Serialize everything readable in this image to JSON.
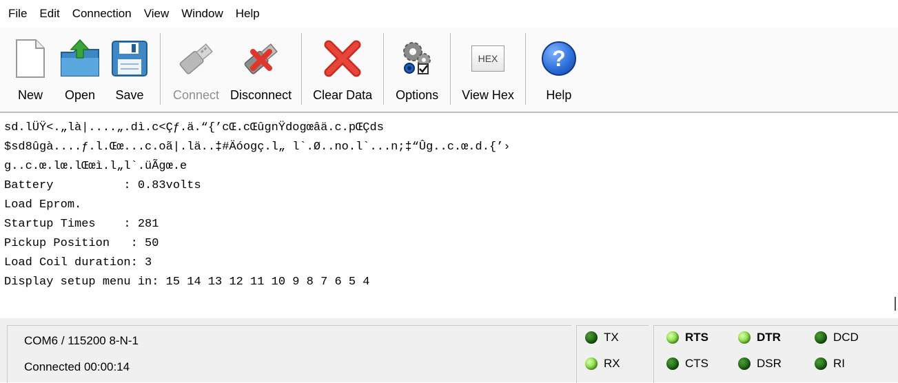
{
  "menu": [
    "File",
    "Edit",
    "Connection",
    "View",
    "Window",
    "Help"
  ],
  "toolbar": {
    "new": {
      "label": "New",
      "icon": "new-document-icon"
    },
    "open": {
      "label": "Open",
      "icon": "open-folder-icon"
    },
    "save": {
      "label": "Save",
      "icon": "floppy-disk-icon"
    },
    "connect": {
      "label": "Connect",
      "icon": "usb-plug-icon",
      "enabled": false
    },
    "disconnect": {
      "label": "Disconnect",
      "icon": "usb-plug-red-x-icon"
    },
    "clear": {
      "label": "Clear Data",
      "icon": "red-x-icon"
    },
    "options": {
      "label": "Options",
      "icon": "gears-options-icon"
    },
    "viewhex": {
      "label": "View Hex",
      "icon": "hex-icon",
      "icon_text": "HEX"
    },
    "help": {
      "label": "Help",
      "icon": "help-question-icon",
      "icon_text": "?"
    }
  },
  "terminal": {
    "lines": [
      "sd.lÜŸ<.„là|....„.dì.c<Çƒ.ä.“{’cŒ.cŒûgnŸdogœâä.c.pŒÇds",
      "$sd8ûgà....ƒ.l.Œœ...c.oã|.lä..‡#Äóogç.l„ l`.Ø..no.l`...n;‡“Ûg..c.œ.d.{’›",
      "g..c.œ.lœ.lŒœì.l„l`.üÃgœ.e",
      "Battery          : 0.83volts",
      "Load Eprom.",
      "Startup Times    : 281",
      "Pickup Position   : 50",
      "Load Coil duration: 3",
      "Display setup menu in: 15 14 13 12 11 10 9 8 7 6 5 4"
    ]
  },
  "status": {
    "port": "COM6 / 115200 8-N-1",
    "connection": "Connected 00:00:14"
  },
  "signals": {
    "tx": {
      "label": "TX",
      "state": "off"
    },
    "rx": {
      "label": "RX",
      "state": "on"
    },
    "rts": {
      "label": "RTS",
      "state": "on"
    },
    "cts": {
      "label": "CTS",
      "state": "off"
    },
    "dtr": {
      "label": "DTR",
      "state": "on"
    },
    "dsr": {
      "label": "DSR",
      "state": "off"
    },
    "dcd": {
      "label": "DCD",
      "state": "off"
    },
    "ri": {
      "label": "RI",
      "state": "off"
    }
  },
  "colors": {
    "led_on": "#8fe04a",
    "led_off": "#1f6b14",
    "delete_red": "#e0362b",
    "help_blue": "#2a6bd8"
  }
}
